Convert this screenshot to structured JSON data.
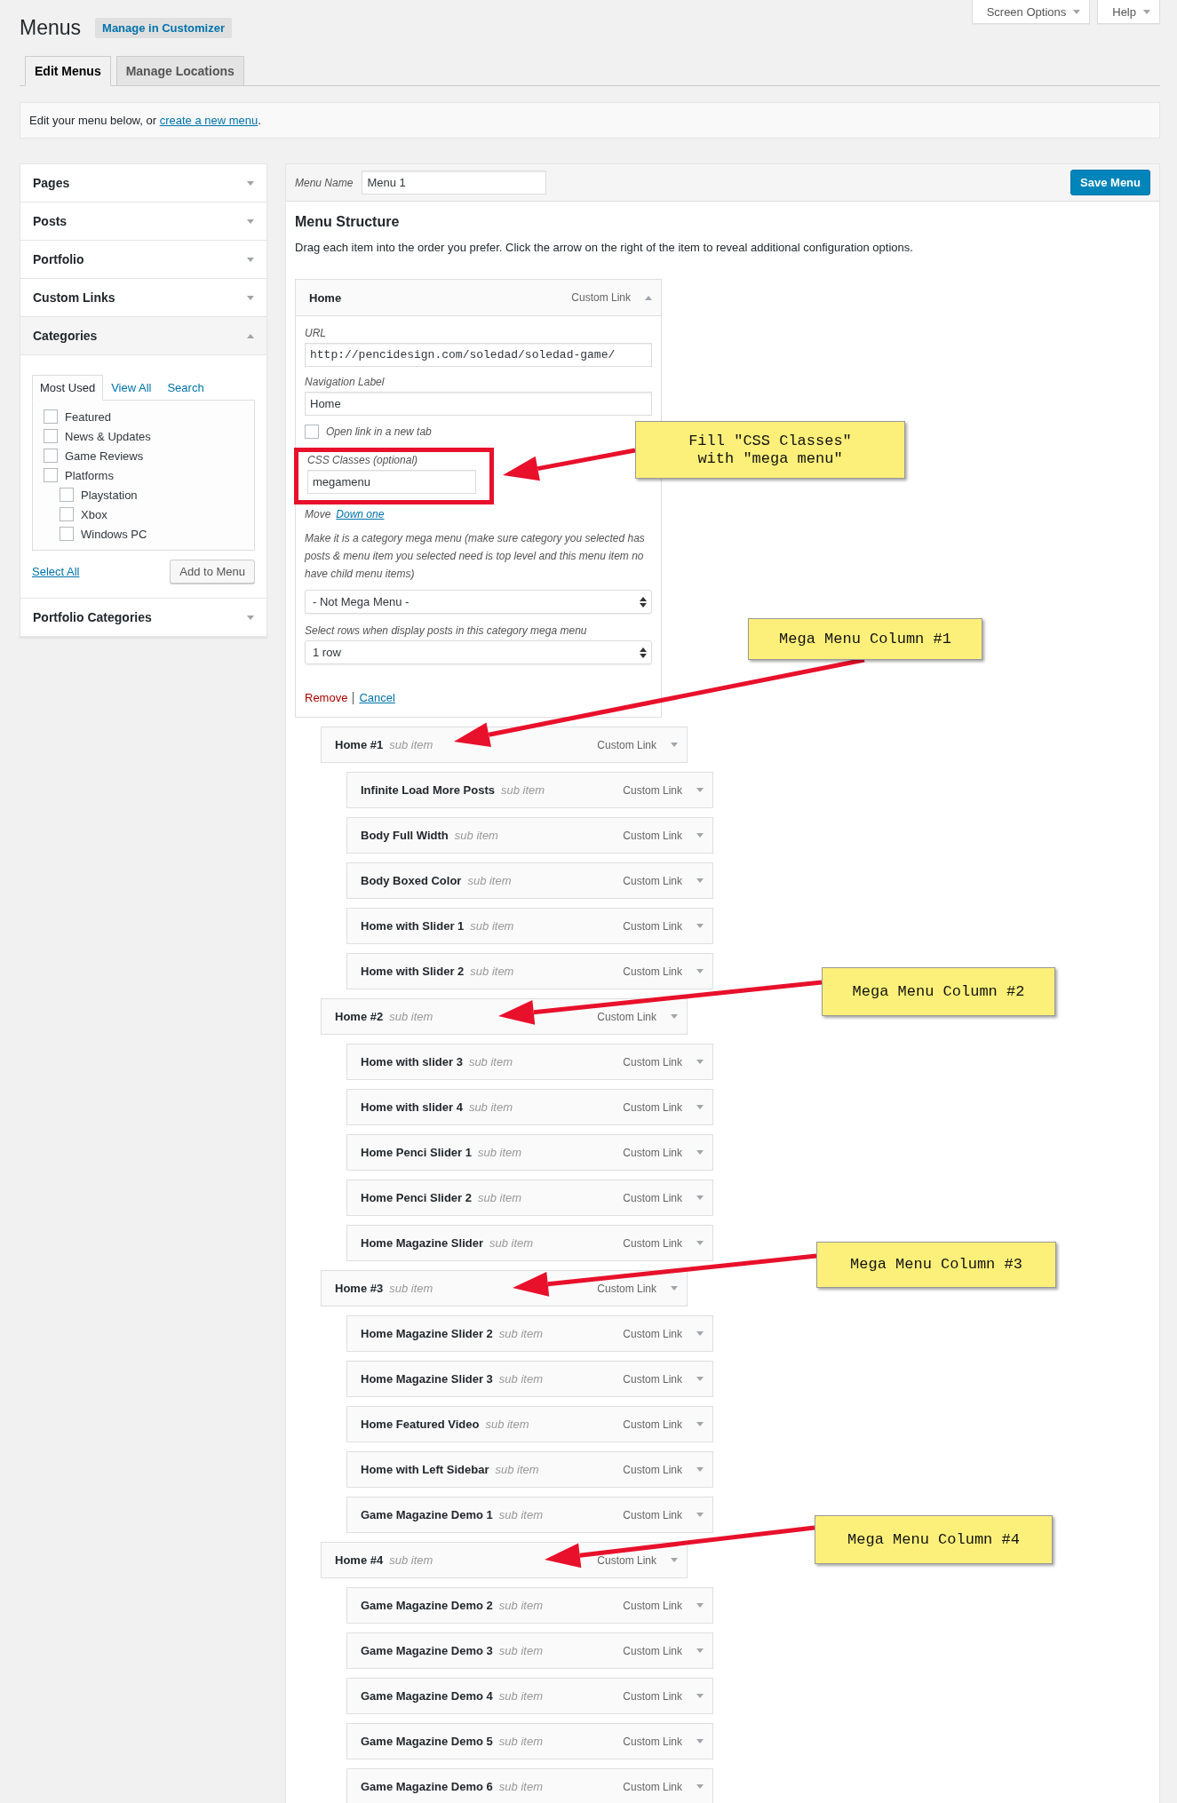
{
  "page": {
    "title": "Menus",
    "customizer_button": "Manage in Customizer",
    "screen_options": "Screen Options",
    "help": "Help"
  },
  "tabs": [
    {
      "label": "Edit Menus",
      "selected": true
    },
    {
      "label": "Manage Locations",
      "selected": false
    }
  ],
  "notice": {
    "text": "Edit your menu below, or ",
    "link": "create a new menu",
    "after": "."
  },
  "sidebar": {
    "panels": [
      {
        "title": "Pages",
        "expanded": false
      },
      {
        "title": "Posts",
        "expanded": false
      },
      {
        "title": "Portfolio",
        "expanded": false
      },
      {
        "title": "Custom Links",
        "expanded": false
      },
      {
        "title": "Categories",
        "expanded": true
      },
      {
        "title": "Portfolio Categories",
        "expanded": false
      }
    ],
    "categories": {
      "tabs": [
        {
          "label": "Most Used",
          "selected": true
        },
        {
          "label": "View All",
          "selected": false
        },
        {
          "label": "Search",
          "selected": false
        }
      ],
      "items": [
        {
          "label": "Featured",
          "checked": false
        },
        {
          "label": "News & Updates",
          "checked": false
        },
        {
          "label": "Game Reviews",
          "checked": false
        },
        {
          "label": "Platforms",
          "checked": false,
          "children": [
            {
              "label": "Playstation",
              "checked": false
            },
            {
              "label": "Xbox",
              "checked": false
            },
            {
              "label": "Windows PC",
              "checked": false
            }
          ]
        }
      ],
      "select_all": "Select All",
      "add_button": "Add to Menu"
    }
  },
  "menu": {
    "name_label": "Menu Name",
    "name_value": "Menu 1",
    "save": "Save Menu",
    "structure_title": "Menu Structure",
    "instructions": "Drag each item into the order you prefer. Click the arrow on the right of the item to reveal additional configuration options.",
    "items": [
      {
        "title": "Home",
        "type": "Custom Link",
        "expanded": true,
        "settings": {
          "url_label": "URL",
          "url": "http://pencidesign.com/soledad/soledad-game/",
          "nav_label": "Navigation Label",
          "nav_value": "Home",
          "new_tab_label": "Open link in a new tab",
          "new_tab_checked": false,
          "css_label": "CSS Classes (optional)",
          "css_value": "megamenu",
          "callout": "Fill \"CSS Classes\"\nwith \"mega menu\"",
          "move_label": "Move",
          "move_link": "Down one",
          "mega_help": "Make it is a category mega menu (make sure category you selected has posts & menu item you selected need is top level and this menu item no have child menu items)",
          "mega_select": "- Not Mega Menu -",
          "rows_label": "Select rows when display posts in this category mega menu",
          "rows_select": "1 row",
          "remove": "Remove",
          "cancel": "Cancel"
        },
        "children": [
          {
            "title": "Home #1",
            "note": "sub item",
            "type": "Custom Link",
            "expanded": false,
            "callout": "Mega Menu Column #1",
            "children": [
              {
                "title": "Infinite Load More Posts",
                "note": "sub item",
                "type": "Custom Link",
                "expanded": false
              },
              {
                "title": "Body Full Width",
                "note": "sub item",
                "type": "Custom Link",
                "expanded": false
              },
              {
                "title": "Body Boxed Color",
                "note": "sub item",
                "type": "Custom Link",
                "expanded": false
              },
              {
                "title": "Home with Slider 1",
                "note": "sub item",
                "type": "Custom Link",
                "expanded": false
              },
              {
                "title": "Home with Slider 2",
                "note": "sub item",
                "type": "Custom Link",
                "expanded": false
              }
            ]
          },
          {
            "title": "Home #2",
            "note": "sub item",
            "type": "Custom Link",
            "expanded": false,
            "callout": "Mega Menu Column #2",
            "children": [
              {
                "title": "Home with slider 3",
                "note": "sub item",
                "type": "Custom Link",
                "expanded": false
              },
              {
                "title": "Home with slider 4",
                "note": "sub item",
                "type": "Custom Link",
                "expanded": false
              },
              {
                "title": "Home Penci Slider 1",
                "note": "sub item",
                "type": "Custom Link",
                "expanded": false
              },
              {
                "title": "Home Penci Slider 2",
                "note": "sub item",
                "type": "Custom Link",
                "expanded": false
              },
              {
                "title": "Home Magazine Slider",
                "note": "sub item",
                "type": "Custom Link",
                "expanded": false
              }
            ]
          },
          {
            "title": "Home #3",
            "note": "sub item",
            "type": "Custom Link",
            "expanded": false,
            "callout": "Mega Menu Column #3",
            "children": [
              {
                "title": "Home Magazine Slider 2",
                "note": "sub item",
                "type": "Custom Link",
                "expanded": false
              },
              {
                "title": "Home Magazine Slider 3",
                "note": "sub item",
                "type": "Custom Link",
                "expanded": false
              },
              {
                "title": "Home Featured Video",
                "note": "sub item",
                "type": "Custom Link",
                "expanded": false
              },
              {
                "title": "Home with Left Sidebar",
                "note": "sub item",
                "type": "Custom Link",
                "expanded": false
              },
              {
                "title": "Game Magazine Demo 1",
                "note": "sub item",
                "type": "Custom Link",
                "expanded": false
              }
            ]
          },
          {
            "title": "Home #4",
            "note": "sub item",
            "type": "Custom Link",
            "expanded": false,
            "callout": "Mega Menu Column #4",
            "children": [
              {
                "title": "Game Magazine Demo 2",
                "note": "sub item",
                "type": "Custom Link",
                "expanded": false
              },
              {
                "title": "Game Magazine Demo 3",
                "note": "sub item",
                "type": "Custom Link",
                "expanded": false
              },
              {
                "title": "Game Magazine Demo 4",
                "note": "sub item",
                "type": "Custom Link",
                "expanded": false
              },
              {
                "title": "Game Magazine Demo 5",
                "note": "sub item",
                "type": "Custom Link",
                "expanded": false
              },
              {
                "title": "Game Magazine Demo 6",
                "note": "sub item",
                "type": "Custom Link",
                "expanded": false
              }
            ]
          }
        ]
      }
    ]
  }
}
